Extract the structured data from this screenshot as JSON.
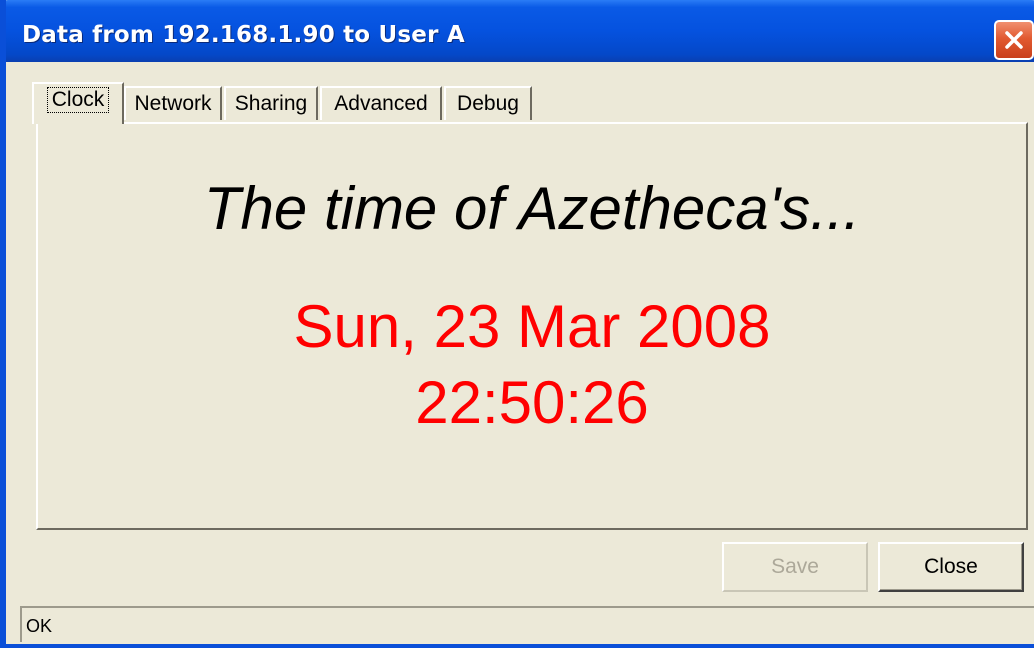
{
  "window": {
    "title": "Data from 192.168.1.90 to User A"
  },
  "tabs": [
    {
      "label": "Clock",
      "active": true
    },
    {
      "label": "Network",
      "active": false
    },
    {
      "label": "Sharing",
      "active": false
    },
    {
      "label": "Advanced",
      "active": false
    },
    {
      "label": "Debug",
      "active": false
    }
  ],
  "clock": {
    "heading": "The time of Azetheca's...",
    "date": "Sun, 23 Mar 2008",
    "time": "22:50:26",
    "value_color": "#ff0000"
  },
  "buttons": {
    "save_label": "Save",
    "save_enabled": false,
    "close_label": "Close"
  },
  "statusbar": {
    "text": "OK"
  },
  "icons": {
    "close": "close-x-icon"
  }
}
